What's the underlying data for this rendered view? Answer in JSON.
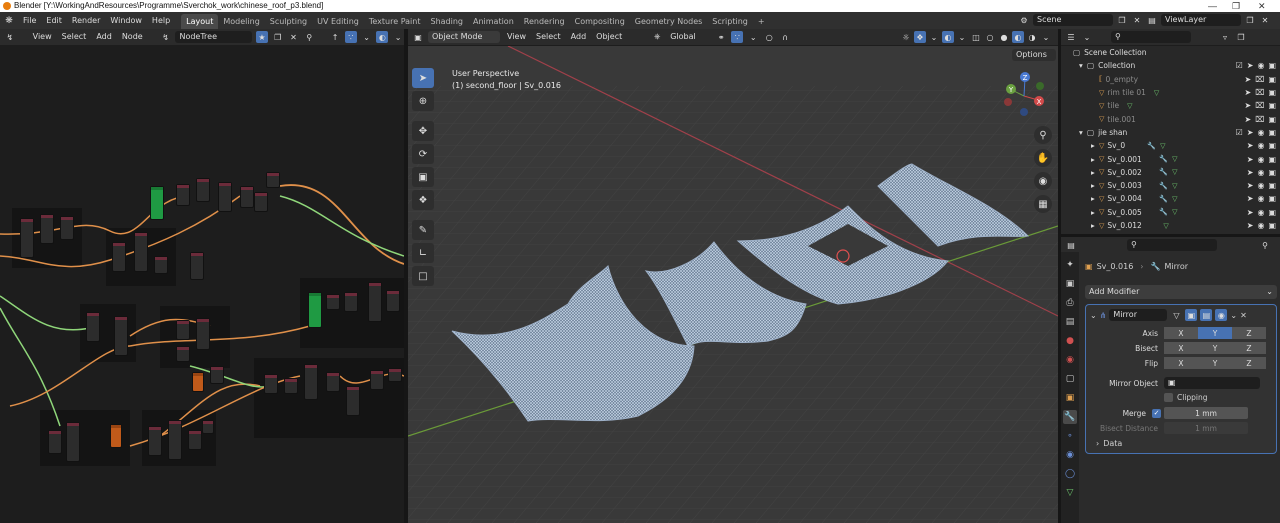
{
  "window": {
    "title": "Blender [Y:\\WorkingAndResources\\Programme\\Sverchok_work\\chinese_roof_p3.blend]"
  },
  "menu": [
    "File",
    "Edit",
    "Render",
    "Window",
    "Help"
  ],
  "workspaces": [
    "Layout",
    "Modeling",
    "Sculpting",
    "UV Editing",
    "Texture Paint",
    "Shading",
    "Animation",
    "Rendering",
    "Compositing",
    "Geometry Nodes",
    "Scripting"
  ],
  "active_workspace": "Layout",
  "scene": {
    "name": "Scene",
    "view_layer": "ViewLayer"
  },
  "node_editor": {
    "menus": [
      "View",
      "Select",
      "Add",
      "Node"
    ],
    "tree_name": "NodeTree"
  },
  "viewport": {
    "mode": "Object Mode",
    "menus": [
      "View",
      "Select",
      "Add",
      "Object"
    ],
    "orientation": "Global",
    "options_label": "Options",
    "perspective_label": "User Perspective",
    "context_label": "(1) second_floor | Sv_0.016",
    "gizmo_axes": [
      "X",
      "Y",
      "Z"
    ]
  },
  "outliner": {
    "root": "Scene Collection",
    "rows": [
      {
        "label": "Collection",
        "type": "collection",
        "level": 1,
        "checked": true
      },
      {
        "label": "0_empty",
        "type": "empty",
        "level": 2,
        "dim": true
      },
      {
        "label": "rim tile 01",
        "type": "mesh",
        "level": 2,
        "dim": true
      },
      {
        "label": "tile",
        "type": "mesh",
        "level": 2,
        "dim": true
      },
      {
        "label": "tile.001",
        "type": "mesh",
        "level": 2,
        "dim": true
      },
      {
        "label": "jie shan",
        "type": "collection",
        "level": 1,
        "checked": true
      },
      {
        "label": "Sv_0",
        "type": "mod",
        "level": 2
      },
      {
        "label": "Sv_0.001",
        "type": "mod",
        "level": 2
      },
      {
        "label": "Sv_0.002",
        "type": "mod",
        "level": 2
      },
      {
        "label": "Sv_0.003",
        "type": "mod",
        "level": 2
      },
      {
        "label": "Sv_0.004",
        "type": "mod",
        "level": 2
      },
      {
        "label": "Sv_0.005",
        "type": "mod",
        "level": 2
      },
      {
        "label": "Sv_0.012",
        "type": "mod",
        "level": 2
      }
    ]
  },
  "properties": {
    "breadcrumb_object": "Sv_0.016",
    "breadcrumb_modifier": "Mirror",
    "add_modifier": "Add Modifier",
    "modifier_name": "Mirror",
    "axis_label": "Axis",
    "bisect_label": "Bisect",
    "flip_label": "Flip",
    "axes": [
      "X",
      "Y",
      "Z"
    ],
    "axis_active": "Y",
    "mirror_object_label": "Mirror Object",
    "clipping_label": "Clipping",
    "merge_label": "Merge",
    "merge_value": "1 mm",
    "bisect_distance_label": "Bisect Distance",
    "bisect_distance_value": "1 mm",
    "data_label": "Data"
  },
  "colors": {
    "accent": "#4772b3",
    "node_header": "#6b2b3a",
    "curve_orange": "#e0904a",
    "curve_green": "#8fd67a",
    "mesh": "#b8c8dc"
  }
}
